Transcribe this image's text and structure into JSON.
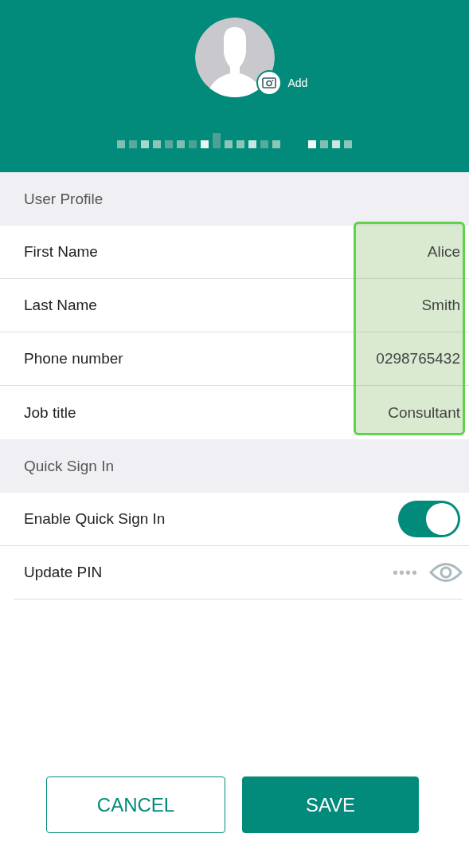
{
  "header": {
    "avatar_action": "Add",
    "name_redacted": true
  },
  "sections": [
    {
      "title": "User Profile",
      "highlighted": true,
      "rows": [
        {
          "kind": "value",
          "label": "First Name",
          "value": "Alice"
        },
        {
          "kind": "value",
          "label": "Last Name",
          "value": "Smith"
        },
        {
          "kind": "value",
          "label": "Phone number",
          "value": "0298765432"
        },
        {
          "kind": "value",
          "label": "Job title",
          "value": "Consultant"
        }
      ]
    },
    {
      "title": "Quick Sign In",
      "rows": [
        {
          "kind": "toggle",
          "label": "Enable Quick Sign In",
          "on": true
        },
        {
          "kind": "pin",
          "label": "Update PIN",
          "value": "••••"
        }
      ]
    }
  ],
  "buttons": [
    {
      "kind": "outline",
      "label": "CANCEL"
    },
    {
      "kind": "filled",
      "label": "SAVE"
    }
  ]
}
